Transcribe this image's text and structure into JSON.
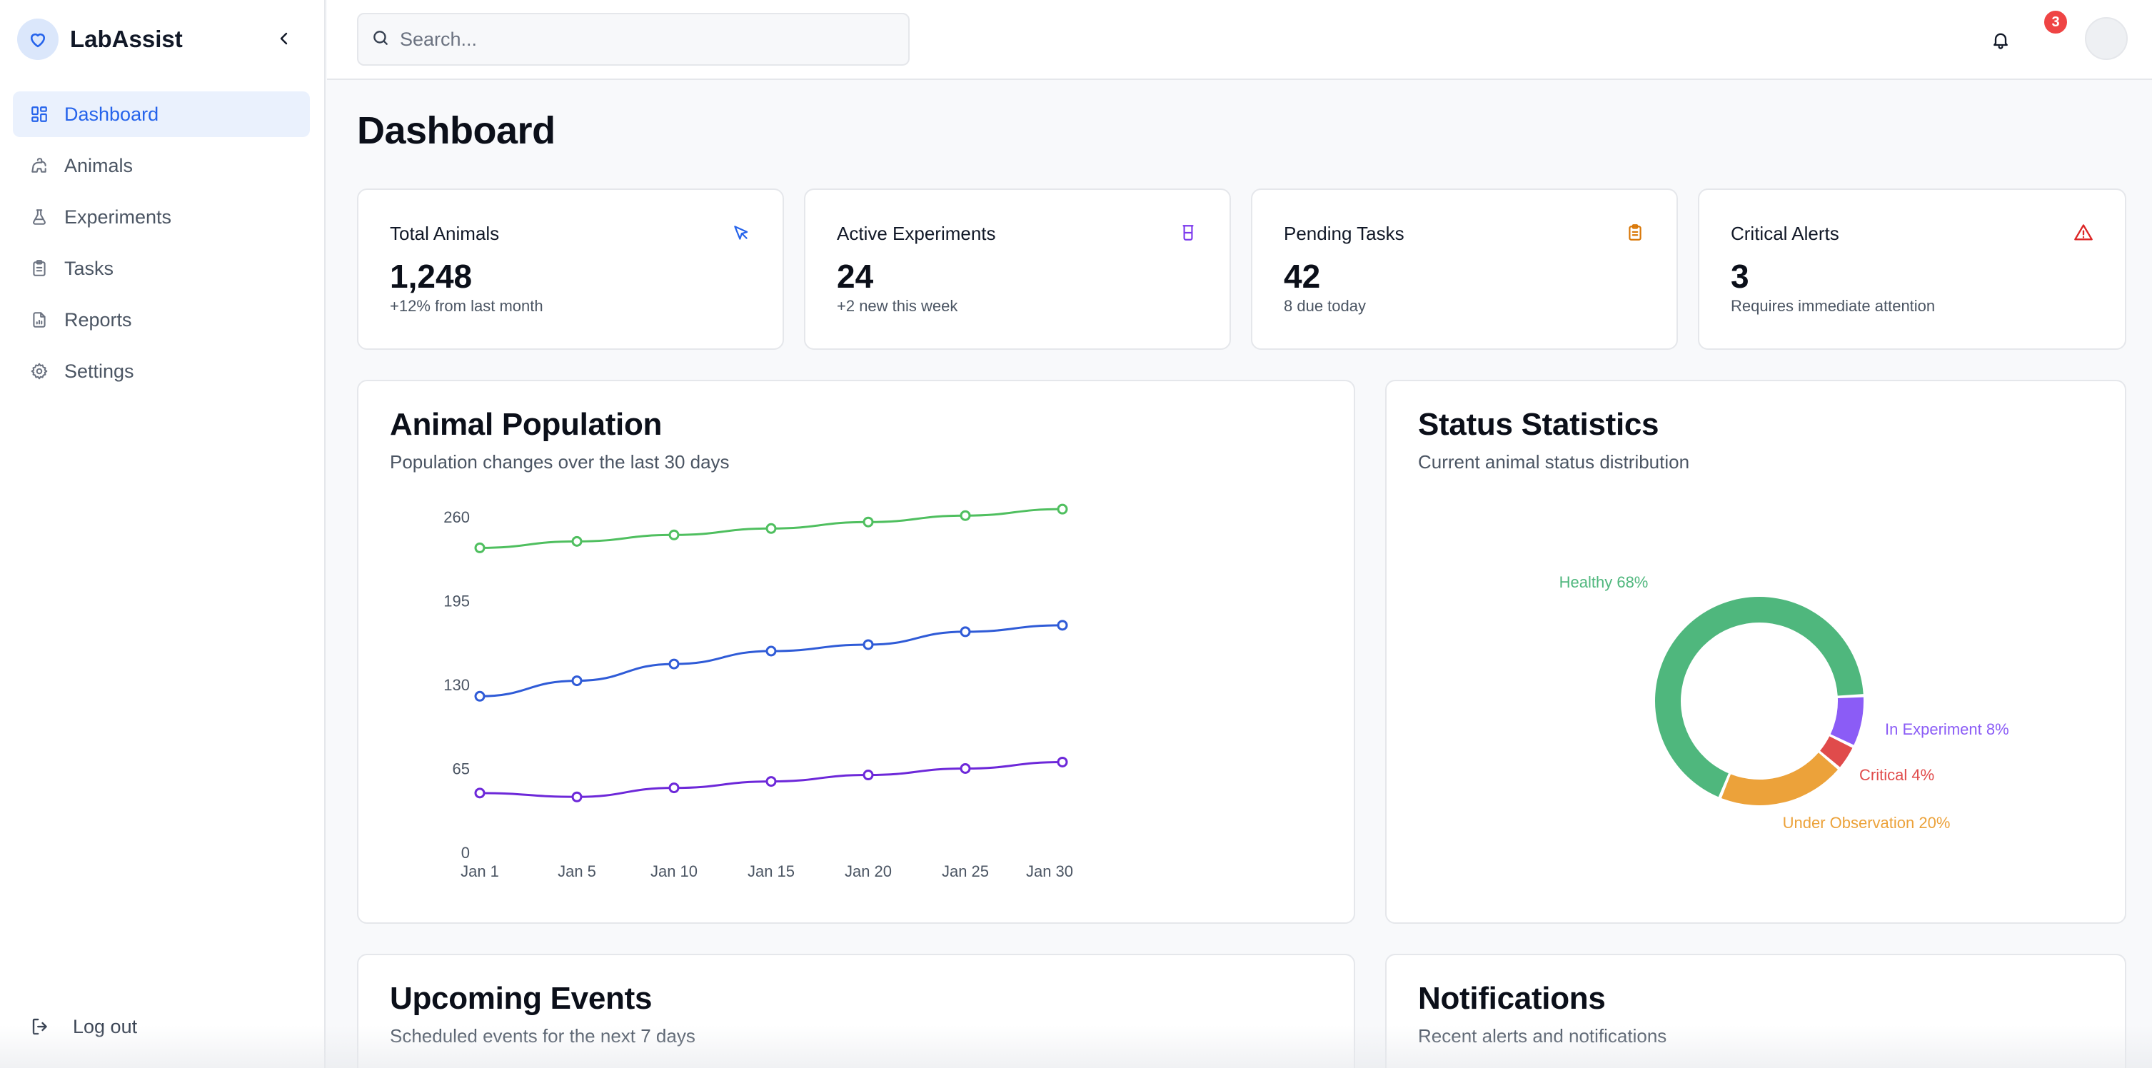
{
  "app": {
    "name": "LabAssist"
  },
  "sidebar": {
    "items": [
      {
        "label": "Dashboard",
        "icon": "dashboard-icon",
        "active": true
      },
      {
        "label": "Animals",
        "icon": "paw-icon",
        "active": false
      },
      {
        "label": "Experiments",
        "icon": "flask-icon",
        "active": false
      },
      {
        "label": "Tasks",
        "icon": "clipboard-icon",
        "active": false
      },
      {
        "label": "Reports",
        "icon": "report-icon",
        "active": false
      },
      {
        "label": "Settings",
        "icon": "gear-icon",
        "active": false
      }
    ],
    "logout_label": "Log out"
  },
  "header": {
    "search_placeholder": "Search...",
    "notification_count": "3"
  },
  "page": {
    "title": "Dashboard"
  },
  "stats": [
    {
      "label": "Total Animals",
      "value": "1,248",
      "sub": "+12% from last month",
      "icon": "cursor-icon",
      "color": "#2563eb"
    },
    {
      "label": "Active Experiments",
      "value": "24",
      "sub": "+2 new this week",
      "icon": "beaker-icon",
      "color": "#7c3aed"
    },
    {
      "label": "Pending Tasks",
      "value": "42",
      "sub": "8 due today",
      "icon": "clipboard-icon",
      "color": "#d97706"
    },
    {
      "label": "Critical Alerts",
      "value": "3",
      "sub": "Requires immediate attention",
      "icon": "alert-triangle-icon",
      "color": "#dc2626"
    }
  ],
  "population": {
    "title": "Animal Population",
    "subtitle": "Population changes over the last 30 days"
  },
  "status": {
    "title": "Status Statistics",
    "subtitle": "Current animal status distribution"
  },
  "events": {
    "title": "Upcoming Events",
    "subtitle": "Scheduled events for the next 7 days"
  },
  "notifications": {
    "title": "Notifications",
    "subtitle": "Recent alerts and notifications"
  },
  "chart_data": [
    {
      "type": "line",
      "x": [
        "Jan 1",
        "Jan 5",
        "Jan 10",
        "Jan 15",
        "Jan 20",
        "Jan 25",
        "Jan 30"
      ],
      "yticks": [
        0,
        65,
        130,
        195,
        260
      ],
      "ylim": [
        0,
        260
      ],
      "grid": false,
      "series": [
        {
          "color": "#4fbf5f",
          "values": [
            236,
            241,
            246,
            251,
            256,
            261,
            266
          ]
        },
        {
          "color": "#2f5bd7",
          "values": [
            121,
            133,
            146,
            156,
            161,
            171,
            176
          ]
        },
        {
          "color": "#6d28d9",
          "values": [
            46,
            43,
            50,
            55,
            60,
            65,
            70
          ]
        }
      ]
    },
    {
      "type": "pie",
      "donut": true,
      "slices": [
        {
          "label": "Healthy 68%",
          "value": 68,
          "color": "#4fb77d"
        },
        {
          "label": "In Experiment 8%",
          "value": 8,
          "color": "#8b5cf6"
        },
        {
          "label": "Critical 4%",
          "value": 4,
          "color": "#e04b4b"
        },
        {
          "label": "Under Observation 20%",
          "value": 20,
          "color": "#eca23a"
        }
      ]
    }
  ]
}
